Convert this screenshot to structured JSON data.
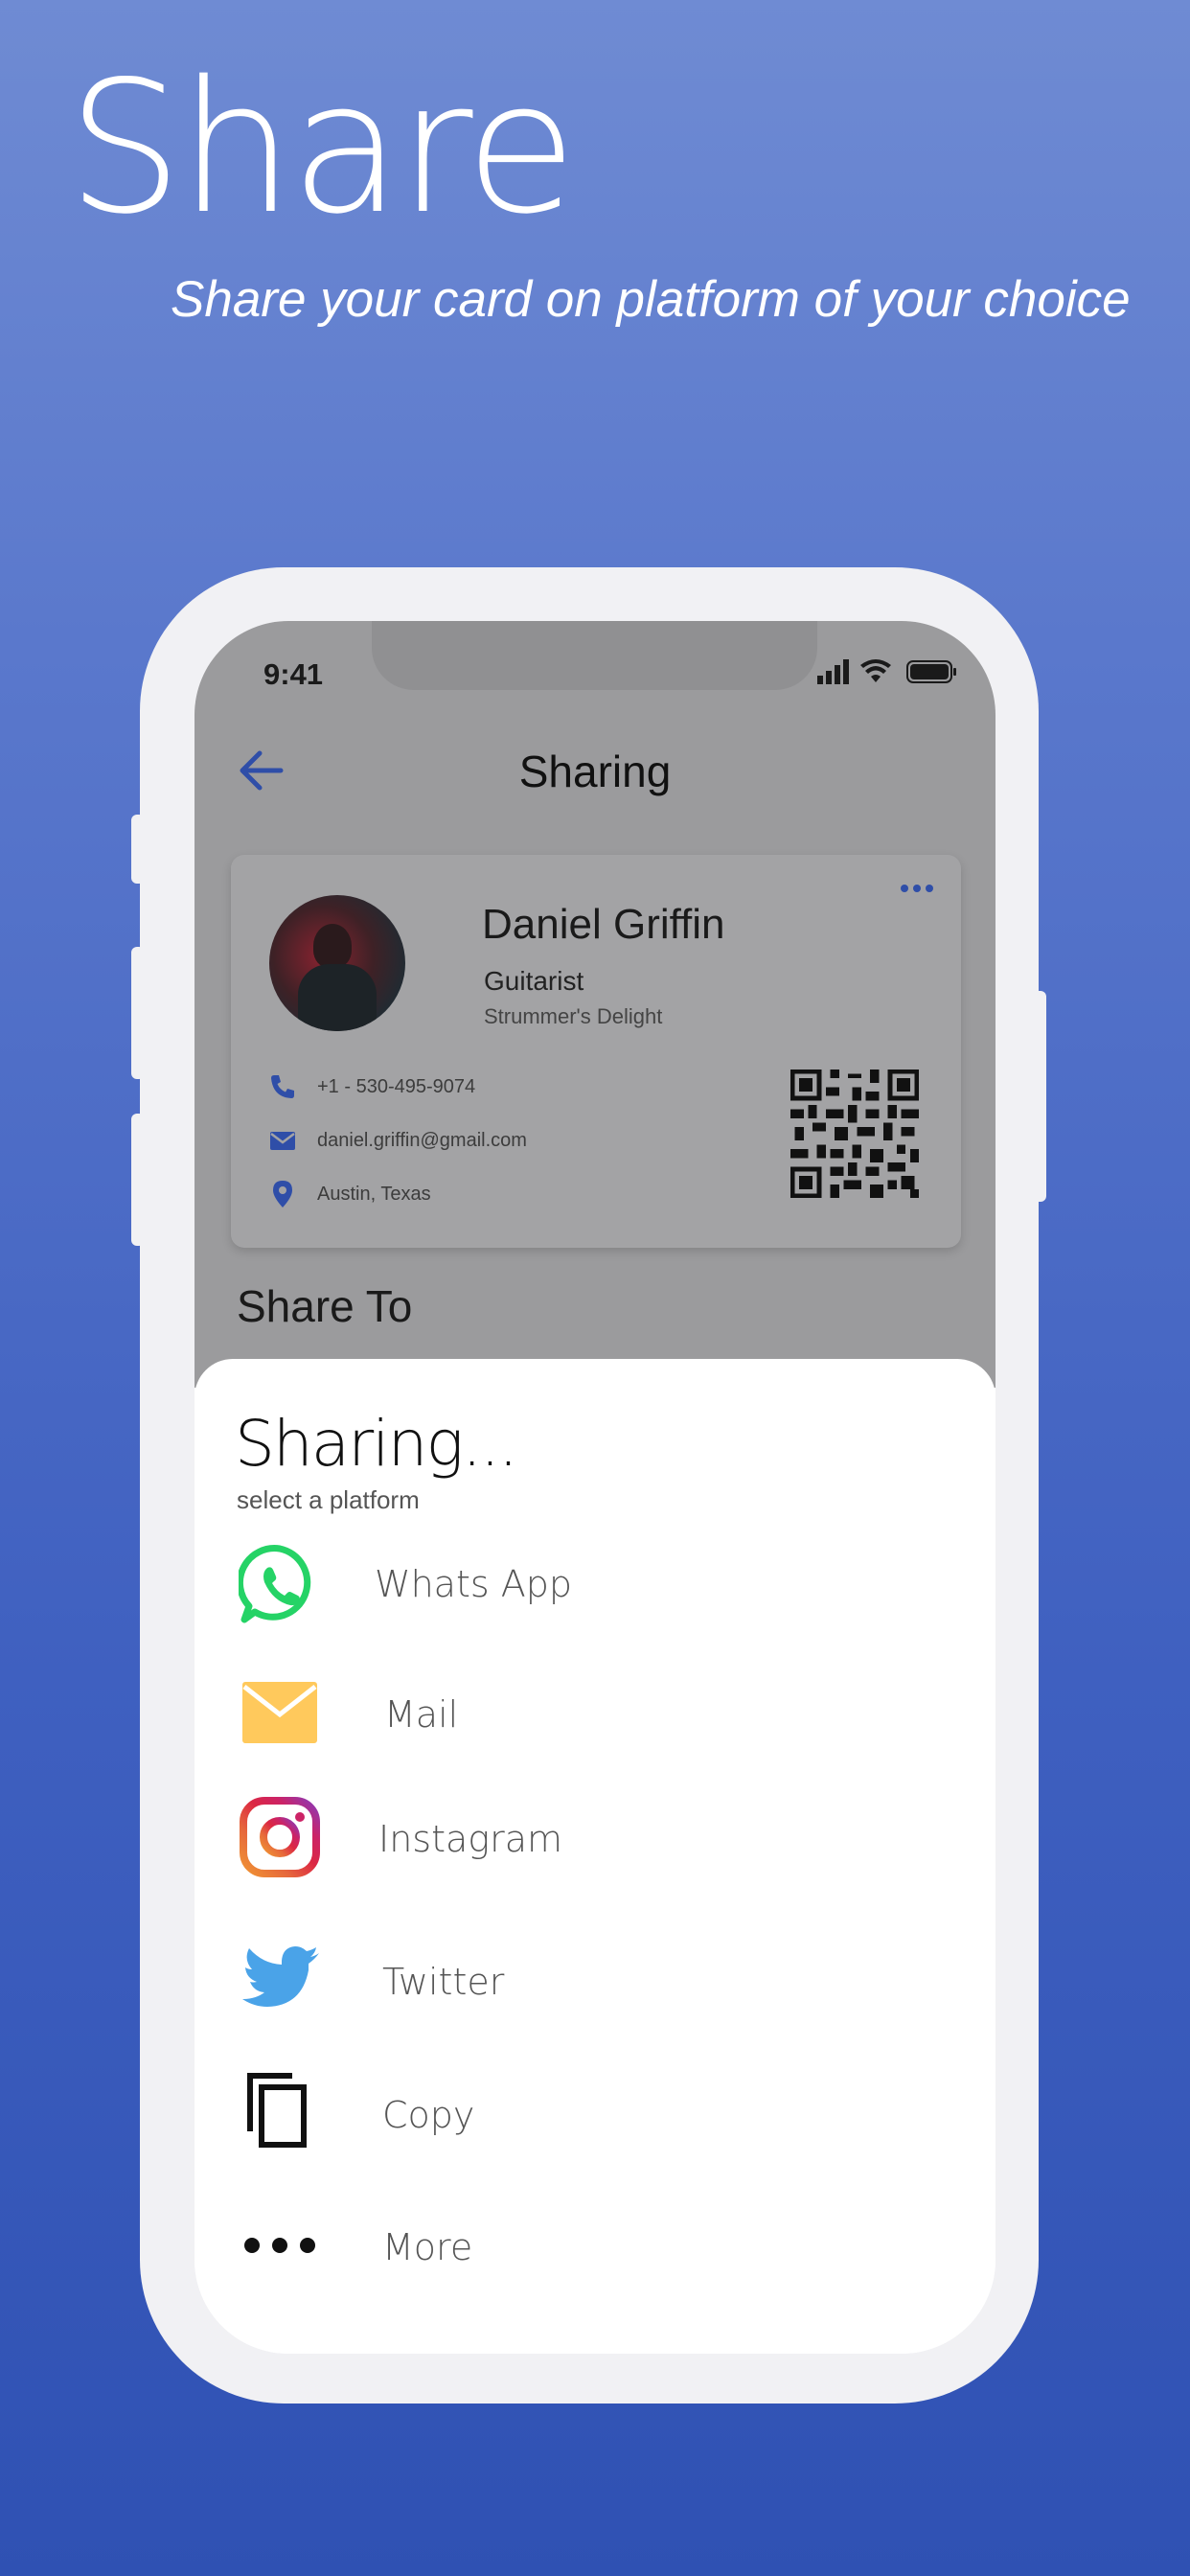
{
  "promo": {
    "title": "Share",
    "subtitle": "Share your card on platform of your choice"
  },
  "status_bar": {
    "time": "9:41"
  },
  "nav": {
    "back_icon": "arrow-left-icon",
    "title": "Sharing"
  },
  "card": {
    "name": "Daniel Griffin",
    "title": "Guitarist",
    "company": "Strummer's Delight",
    "phone": "+1 - 530-495-9074",
    "email": "daniel.griffin@gmail.com",
    "location": "Austin, Texas"
  },
  "share_to_label": "Share To",
  "sheet": {
    "title": "Sharing...",
    "subtitle": "select a platform",
    "platforms": [
      {
        "label": "Whats App",
        "icon": "whatsapp-icon",
        "color": "#25d366"
      },
      {
        "label": "Mail",
        "icon": "mail-icon",
        "color": "#ffc95c"
      },
      {
        "label": "Instagram",
        "icon": "instagram-icon",
        "color": "#c13584"
      },
      {
        "label": "Twitter",
        "icon": "twitter-icon",
        "color": "#4aa3e8"
      },
      {
        "label": "Copy",
        "icon": "copy-icon",
        "color": "#111111"
      },
      {
        "label": "More",
        "icon": "more-icon",
        "color": "#111111"
      }
    ]
  },
  "colors": {
    "accent": "#2f4ea8",
    "background_top": "#6f8bd3",
    "background_bottom": "#2f51b3"
  }
}
